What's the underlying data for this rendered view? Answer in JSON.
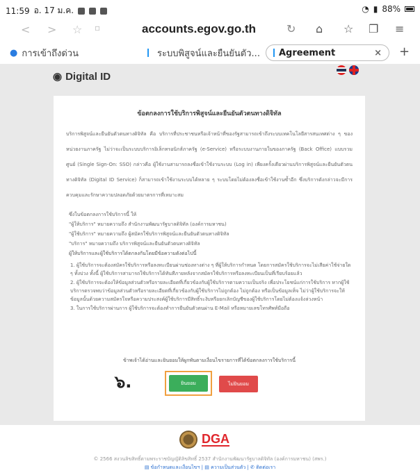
{
  "statusbar": {
    "time": "11:59",
    "date": "อ. 17 ม.ค.",
    "battery": "88%"
  },
  "browser": {
    "url": "accounts.egov.go.th",
    "tabs": [
      {
        "label": "การเข้าถึงด่วน"
      },
      {
        "label": "ระบบพิสูจน์และยืนยันตัว..."
      },
      {
        "label": "Agreement",
        "close": "×"
      }
    ],
    "new_tab": "+"
  },
  "site": {
    "logo_text": "Digital ID"
  },
  "agreement": {
    "title": "ข้อตกลงการใช้บริการพิสูจน์และยืนยันตัวตนทางดิจิทัล",
    "intro": "บริการพิสูจน์และยืนยันตัวตนทางดิจิทัล คือ บริการที่ประชาชนหรือเจ้าหน้าที่ของรัฐสามารถเข้าถึงระบบเทคโนโลยีสารสนเทศต่าง ๆ ของหน่วยงานภาครัฐ ไม่ว่าจะเป็นระบบบริการอิเล็กทรอนิกส์ภาครัฐ (e-Service) หรือระบบงานภายในของภาครัฐ (Back Office) แบบรวมศูนย์ (Single Sign-On: SSO) กล่าวคือ ผู้ใช้งานสามารถลงชื่อเข้าใช้งานระบบ (Log in) เพียงครั้งเดียวผ่านบริการพิสูจน์และยืนยันตัวตนทางดิจิทัล (Digital ID Service) ก็สามารถเข้าใช้งานระบบได้หลาย ๆ ระบบโดยไม่ต้องลงชื่อเข้าใช้งานซ้ำอีก ซึ่งบริการดังกล่าวจะมีการควบคุมและรักษาความปลอดภัยด้วยมาตรการที่เหมาะสม",
    "defs": [
      "ซึ่งในข้อตกลงการใช้บริการนี้ ให้",
      "\"ผู้ให้บริการ\" หมายความถึง สำนักงานพัฒนารัฐบาลดิจิทัล (องค์การมหาชน)",
      "\"ผู้ใช้บริการ\" หมายความถึง ผู้สมัครใช้บริการพิสูจน์และยืนยันตัวตนทางดิจิทัล",
      "\"บริการ\" หมายความถึง บริการพิสูจน์และยืนยันตัวตนทางดิจิทัล",
      "ผู้ให้บริการและผู้ใช้บริการได้ตกลงกันโดยมีข้อความดังต่อไปนี้"
    ],
    "items": [
      "1. ผู้ใช้บริการจะต้องสมัครใช้บริการหรือลงทะเบียนผ่านช่องทางต่าง ๆ ที่ผู้ให้บริการกำหนด โดยการสมัครใช้บริการจะไม่เสียค่าใช้จ่ายใด ๆ ทั้งปวง ทั้งนี้ ผู้ใช้บริการสามารถใช้บริการได้ทันทีภายหลังจากสมัครใช้บริการหรือลงทะเบียนเป็นที่เรียบร้อยแล้ว",
      "2. ผู้ใช้บริการจะต้องให้ข้อมูลส่วนตัวหรือรายละเอียดที่เกี่ยวข้องกับผู้ใช้บริการตามความเป็นจริง เพื่อประโยชน์แก่การใช้บริการ หากผู้ใช้บริการตรวจพบว่าข้อมูลส่วนตัวหรือรายละเอียดที่เกี่ยวข้องกับผู้ใช้บริการไม่ถูกต้อง ไม่ถูกต้อง หรือเป็นข้อมูลเท็จ ไม่ว่าผู้ใช้บริการจะให้ข้อมูลนั้นด้วยความสมัครใจหรือความประสงค์ผู้ใช้บริการมีสิทธิ์ระงับหรือยกเลิกบัญชีของผู้ใช้บริการโดยไม่ต้องแจ้งล่วงหน้า",
      "3. ในการใช้บริการผ่านการ ผู้ใช้บริการจะต้องทำการยืนยันตัวตนผ่าน E-Mail หรือหมายเลขโทรศัพท์มือถือ"
    ],
    "confirm_text": "ข้าพเจ้าได้อ่านและยินยอมให้ผูกพันตามเงื่อนไขรายการที่ได้ข้อตกลงการใช้บริการนี้",
    "step_marker": "๖.",
    "agree_label": "ยินยอม",
    "decline_label": "ไม่ยินยอม"
  },
  "footer": {
    "org_logo": "DGA",
    "copyright": "© 2566 สงวนลิขสิทธิ์ตามพระราชบัญญัติลิขสิทธิ์ 2537 สำนักงานพัฒนารัฐบาลดิจิทัล (องค์การมหาชน) (สพร.)",
    "link_terms": "ข้อกำหนดและเงื่อนไขฯ",
    "link_privacy": "ความเป็นส่วนตัว",
    "link_contact": "ติดต่อเรา"
  },
  "colors": {
    "agree": "#3bae5b",
    "decline": "#e04a4a",
    "highlight": "#f0a040",
    "dga_red": "#e0262c"
  }
}
